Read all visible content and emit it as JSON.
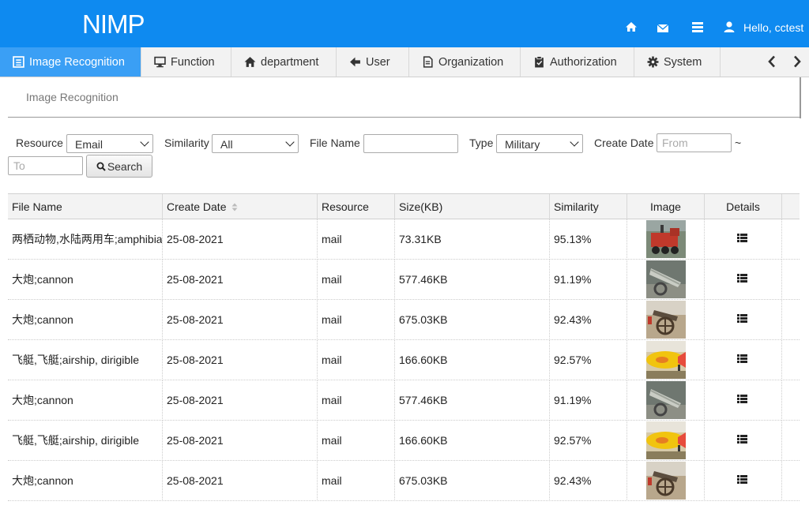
{
  "header": {
    "logo": "NIMP",
    "greeting": "Hello, cctest",
    "icons": [
      "home-icon",
      "mail-icon",
      "list-icon",
      "user-icon"
    ]
  },
  "tabs": [
    {
      "label": "Image Recognition",
      "icon": "picture-icon",
      "active": true
    },
    {
      "label": "Function",
      "icon": "monitor-icon"
    },
    {
      "label": "department",
      "icon": "home-icon"
    },
    {
      "label": "User",
      "icon": "arrow-left-icon"
    },
    {
      "label": "Organization",
      "icon": "document-icon"
    },
    {
      "label": "Authorization",
      "icon": "clipboard-icon"
    },
    {
      "label": "System",
      "icon": "gear-icon"
    }
  ],
  "page_title": "Image Recognition",
  "filters": {
    "resource_label": "Resource",
    "resource_value": "Email",
    "similarity_label": "Similarity",
    "similarity_value": "All",
    "filename_label": "File Name",
    "filename_value": "",
    "type_label": "Type",
    "type_value": "Military",
    "createdate_label": "Create Date",
    "from_placeholder": "From",
    "tilde": "~",
    "to_placeholder": "To",
    "search_label": "Search"
  },
  "table": {
    "headers": [
      "File Name",
      "Create Date",
      "Resource",
      "Size(KB)",
      "Similarity",
      "Image",
      "Details"
    ],
    "rows": [
      {
        "file": "两栖动物,水陆两用车;amphibian, amphibious vehicle",
        "date": "25-08-2021",
        "resource": "mail",
        "size": "73.31KB",
        "similarity": "95.13%",
        "image": "amphibian"
      },
      {
        "file": "大炮;cannon",
        "date": "25-08-2021",
        "resource": "mail",
        "size": "577.46KB",
        "similarity": "91.19%",
        "image": "cannon-grey"
      },
      {
        "file": "大炮;cannon",
        "date": "25-08-2021",
        "resource": "mail",
        "size": "675.03KB",
        "similarity": "92.43%",
        "image": "cannon-wood"
      },
      {
        "file": "飞艇,飞艇;airship, dirigible",
        "date": "25-08-2021",
        "resource": "mail",
        "size": "166.60KB",
        "similarity": "92.57%",
        "image": "airship"
      },
      {
        "file": "大炮;cannon",
        "date": "25-08-2021",
        "resource": "mail",
        "size": "577.46KB",
        "similarity": "91.19%",
        "image": "cannon-grey"
      },
      {
        "file": "飞艇,飞艇;airship, dirigible",
        "date": "25-08-2021",
        "resource": "mail",
        "size": "166.60KB",
        "similarity": "92.57%",
        "image": "airship"
      },
      {
        "file": "大炮;cannon",
        "date": "25-08-2021",
        "resource": "mail",
        "size": "675.03KB",
        "similarity": "92.43%",
        "image": "cannon-wood"
      }
    ]
  },
  "colors": {
    "header_bg": "#0e8af0",
    "active_tab": "#3a9ff5"
  }
}
